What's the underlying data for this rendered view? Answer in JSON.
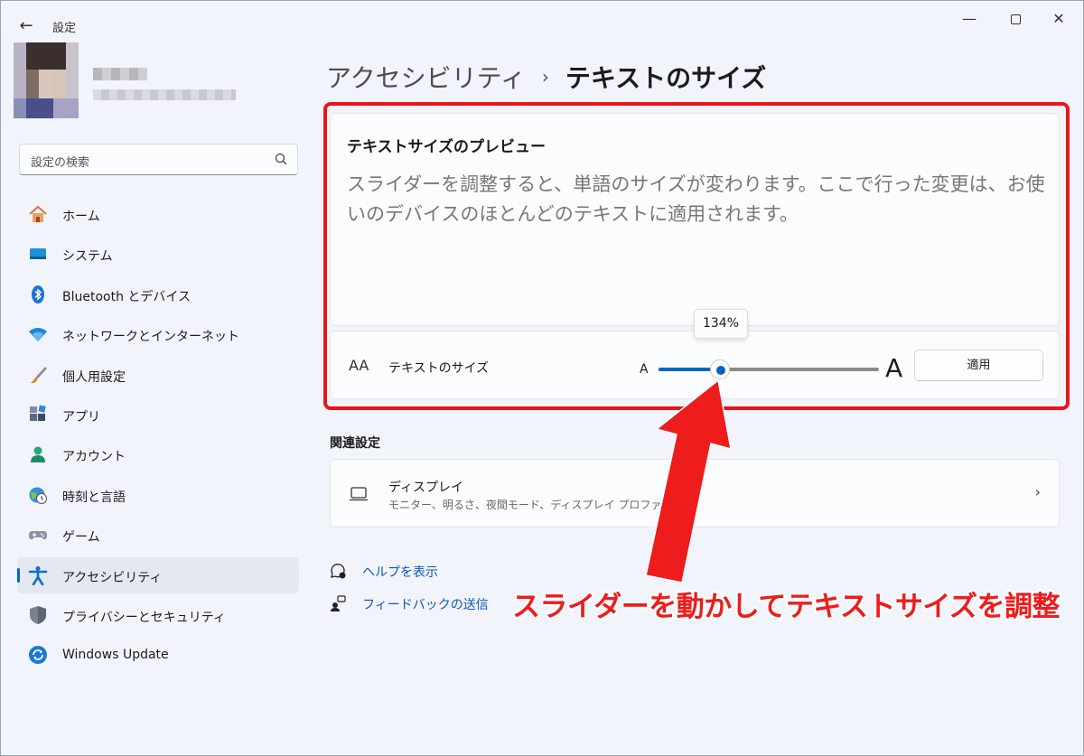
{
  "window": {
    "app_title": "設定",
    "back_glyph": "←",
    "minimize_glyph": "—",
    "close_glyph": "✕"
  },
  "search": {
    "placeholder": "設定の検索"
  },
  "sidebar": {
    "items": [
      {
        "label": "ホーム",
        "icon": "home-icon",
        "selected": false
      },
      {
        "label": "システム",
        "icon": "system-icon",
        "selected": false
      },
      {
        "label": "Bluetooth とデバイス",
        "icon": "bluetooth-icon",
        "selected": false
      },
      {
        "label": "ネットワークとインターネット",
        "icon": "wifi-icon",
        "selected": false
      },
      {
        "label": "個人用設定",
        "icon": "brush-icon",
        "selected": false
      },
      {
        "label": "アプリ",
        "icon": "apps-icon",
        "selected": false
      },
      {
        "label": "アカウント",
        "icon": "account-icon",
        "selected": false
      },
      {
        "label": "時刻と言語",
        "icon": "clock-globe-icon",
        "selected": false
      },
      {
        "label": "ゲーム",
        "icon": "gamepad-icon",
        "selected": false
      },
      {
        "label": "アクセシビリティ",
        "icon": "accessibility-icon",
        "selected": true
      },
      {
        "label": "プライバシーとセキュリティ",
        "icon": "shield-icon",
        "selected": false
      },
      {
        "label": "Windows Update",
        "icon": "update-icon",
        "selected": false
      }
    ]
  },
  "header": {
    "parent": "アクセシビリティ",
    "separator": "›",
    "current": "テキストのサイズ"
  },
  "preview": {
    "title": "テキストサイズのプレビュー",
    "body": "スライダーを調整すると、単語のサイズが変わります。ここで行った変更は、お使いのデバイスのほとんどのテキストに適用されます。"
  },
  "text_size": {
    "icon_glyph": "AA",
    "label": "テキストのサイズ",
    "small_a": "A",
    "big_a": "A",
    "value_label": "134%",
    "slider_fraction": 0.28,
    "apply_label": "適用"
  },
  "related": {
    "title": "関連設定",
    "display_title": "ディスプレイ",
    "display_sub": "モニター、明るさ、夜間モード、ディスプレイ プロファイル",
    "chevron": "›"
  },
  "links": {
    "help": "ヘルプを表示",
    "feedback": "フィードバックの送信"
  },
  "annotation": {
    "text": "スライダーを動かしてテキストサイズを調整",
    "color": "#ee1c1c"
  },
  "colors": {
    "accent": "#0067c0",
    "highlight": "#e8151a"
  }
}
